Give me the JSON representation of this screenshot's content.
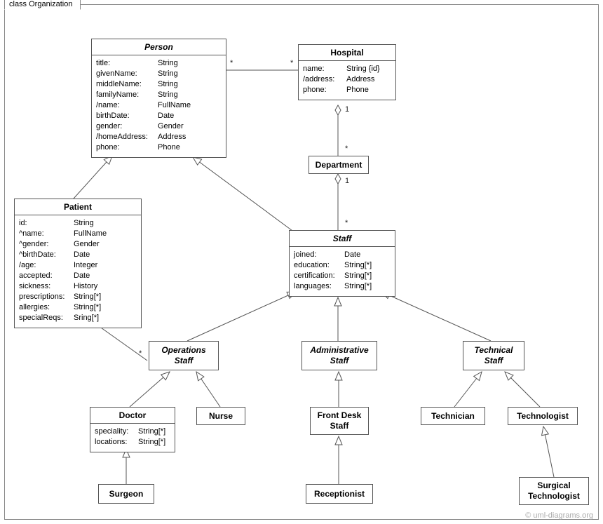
{
  "frame": {
    "title": "class Organization"
  },
  "watermark": "© uml-diagrams.org",
  "classes": {
    "person": {
      "name": "Person",
      "attrs": [
        {
          "n": "title:",
          "t": "String"
        },
        {
          "n": "givenName:",
          "t": "String"
        },
        {
          "n": "middleName:",
          "t": "String"
        },
        {
          "n": "familyName:",
          "t": "String"
        },
        {
          "n": "/name:",
          "t": "FullName"
        },
        {
          "n": "birthDate:",
          "t": "Date"
        },
        {
          "n": "gender:",
          "t": "Gender"
        },
        {
          "n": "/homeAddress:",
          "t": "Address"
        },
        {
          "n": "phone:",
          "t": "Phone"
        }
      ]
    },
    "hospital": {
      "name": "Hospital",
      "attrs": [
        {
          "n": "name:",
          "t": "String {id}"
        },
        {
          "n": "/address:",
          "t": "Address"
        },
        {
          "n": "phone:",
          "t": "Phone"
        }
      ]
    },
    "department": {
      "name": "Department"
    },
    "patient": {
      "name": "Patient",
      "attrs": [
        {
          "n": "id:",
          "t": "String"
        },
        {
          "n": "^name:",
          "t": "FullName"
        },
        {
          "n": "^gender:",
          "t": "Gender"
        },
        {
          "n": "^birthDate:",
          "t": "Date"
        },
        {
          "n": "/age:",
          "t": "Integer"
        },
        {
          "n": "accepted:",
          "t": "Date"
        },
        {
          "n": "sickness:",
          "t": "History"
        },
        {
          "n": "prescriptions:",
          "t": "String[*]"
        },
        {
          "n": "allergies:",
          "t": "String[*]"
        },
        {
          "n": "specialReqs:",
          "t": "Sring[*]"
        }
      ]
    },
    "staff": {
      "name": "Staff",
      "attrs": [
        {
          "n": "joined:",
          "t": "Date"
        },
        {
          "n": "education:",
          "t": "String[*]"
        },
        {
          "n": "certification:",
          "t": "String[*]"
        },
        {
          "n": "languages:",
          "t": "String[*]"
        }
      ]
    },
    "opsStaff": {
      "name": "Operations",
      "name2": "Staff"
    },
    "adminStaff": {
      "name": "Administrative",
      "name2": "Staff"
    },
    "techStaff": {
      "name": "Technical",
      "name2": "Staff"
    },
    "doctor": {
      "name": "Doctor",
      "attrs": [
        {
          "n": "speciality:",
          "t": "String[*]"
        },
        {
          "n": "locations:",
          "t": "String[*]"
        }
      ]
    },
    "nurse": {
      "name": "Nurse"
    },
    "frontDesk": {
      "name": "Front Desk",
      "name2": "Staff"
    },
    "technician": {
      "name": "Technician"
    },
    "technologist": {
      "name": "Technologist"
    },
    "surgeon": {
      "name": "Surgeon"
    },
    "receptionist": {
      "name": "Receptionist"
    },
    "surgTech": {
      "name": "Surgical",
      "name2": "Technologist"
    }
  },
  "mult": {
    "personHosp_l": "*",
    "personHosp_r": "*",
    "hospDept_top": "1",
    "hospDept_bot": "*",
    "deptStaff_top": "1",
    "deptStaff_bot": "*",
    "patientOps_l": "*",
    "patientOps_r": "*"
  }
}
